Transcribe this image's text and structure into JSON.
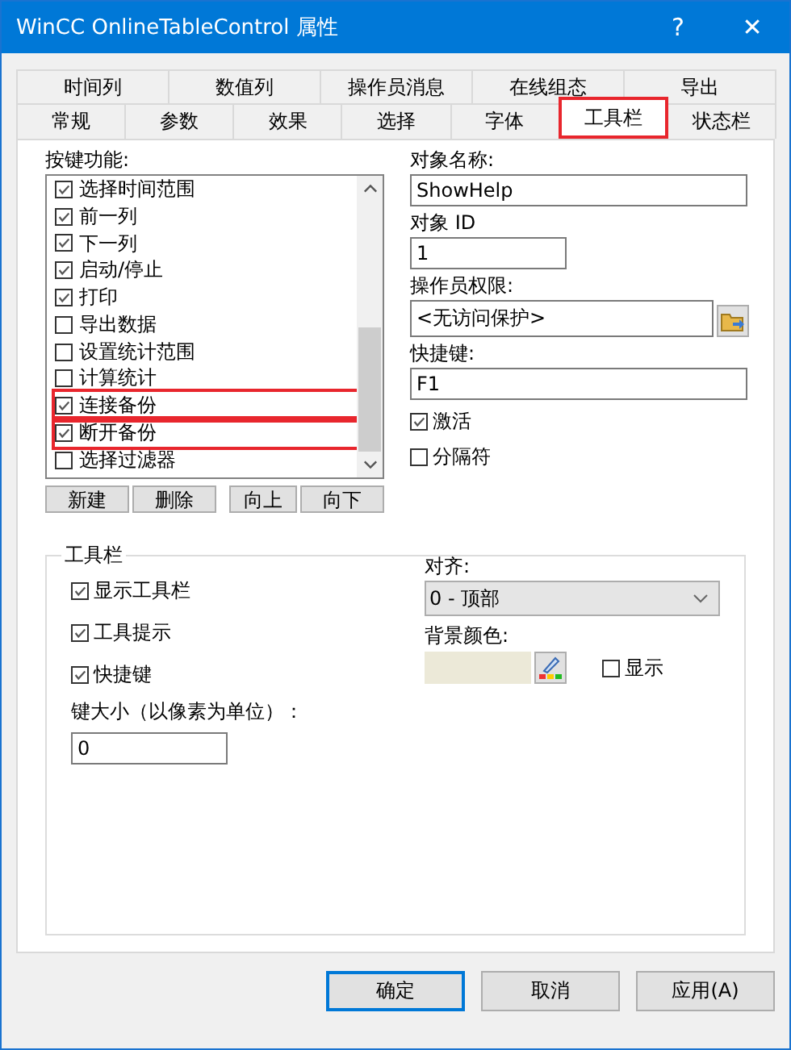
{
  "window": {
    "title": "WinCC OnlineTableControl 属性",
    "help": "?",
    "close": "✕"
  },
  "tab_rows": [
    [
      {
        "label": "时间列",
        "selected": false,
        "highlighted": false
      },
      {
        "label": "数值列",
        "selected": false,
        "highlighted": false
      },
      {
        "label": "操作员消息",
        "selected": false,
        "highlighted": false
      },
      {
        "label": "在线组态",
        "selected": false,
        "highlighted": false
      },
      {
        "label": "导出",
        "selected": false,
        "highlighted": false
      }
    ],
    [
      {
        "label": "常规",
        "selected": false,
        "highlighted": false
      },
      {
        "label": "参数",
        "selected": false,
        "highlighted": false
      },
      {
        "label": "效果",
        "selected": false,
        "highlighted": false
      },
      {
        "label": "选择",
        "selected": false,
        "highlighted": false
      },
      {
        "label": "字体",
        "selected": false,
        "highlighted": false
      },
      {
        "label": "工具栏",
        "selected": true,
        "highlighted": true
      },
      {
        "label": "状态栏",
        "selected": false,
        "highlighted": false
      }
    ]
  ],
  "key_functions": {
    "label": "按键功能:",
    "items": [
      {
        "label": "选择时间范围",
        "checked": true,
        "highlighted": false
      },
      {
        "label": "前一列",
        "checked": true,
        "highlighted": false
      },
      {
        "label": "下一列",
        "checked": true,
        "highlighted": false
      },
      {
        "label": "启动/停止",
        "checked": true,
        "highlighted": false
      },
      {
        "label": "打印",
        "checked": true,
        "highlighted": false
      },
      {
        "label": "导出数据",
        "checked": false,
        "highlighted": false
      },
      {
        "label": "设置统计范围",
        "checked": false,
        "highlighted": false
      },
      {
        "label": "计算统计",
        "checked": false,
        "highlighted": false
      },
      {
        "label": "连接备份",
        "checked": true,
        "highlighted": true
      },
      {
        "label": "断开备份",
        "checked": true,
        "highlighted": true
      },
      {
        "label": "选择过滤器",
        "checked": false,
        "highlighted": false
      }
    ],
    "buttons": [
      "新建",
      "删除",
      "向上",
      "向下"
    ]
  },
  "object": {
    "name_label": "对象名称:",
    "name": "ShowHelp",
    "id_label": "对象 ID",
    "id": "1",
    "auth_label": "操作员权限:",
    "auth": "<无访问保护>",
    "hotkey_label": "快捷键:",
    "hotkey": "F1",
    "options": [
      {
        "label": "激活",
        "checked": true
      },
      {
        "label": "分隔符",
        "checked": false
      }
    ]
  },
  "toolbar_group": {
    "title": "工具栏",
    "options": [
      {
        "label": "显示工具栏",
        "checked": true
      },
      {
        "label": "工具提示",
        "checked": true
      },
      {
        "label": "快捷键",
        "checked": true
      }
    ],
    "size_label": "键大小（以像素为单位）：",
    "size": "0",
    "align_label": "对齐:",
    "align": "0 - 顶部",
    "bg_label": "背景颜色:",
    "show": {
      "label": "显示",
      "checked": false
    }
  },
  "buttons": [
    {
      "label": "确定",
      "default": true
    },
    {
      "label": "取消",
      "default": false
    },
    {
      "label": "应用(A)",
      "default": false
    }
  ]
}
